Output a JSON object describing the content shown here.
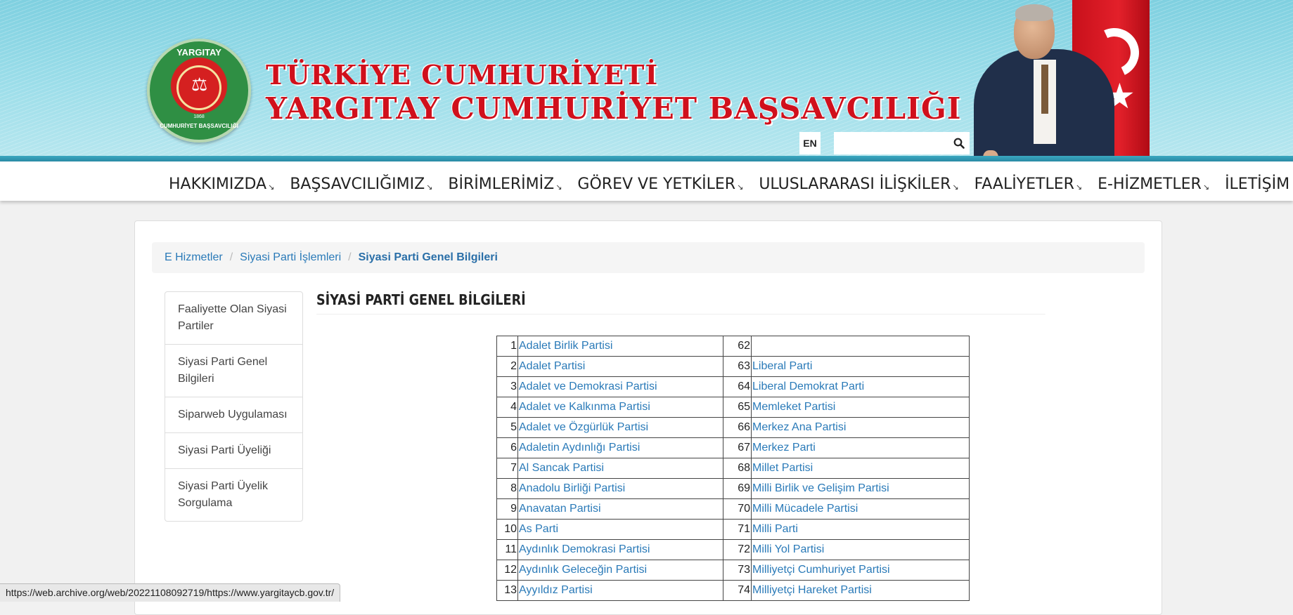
{
  "header": {
    "seal_top": "YARGITAY",
    "seal_bottom": "CUMHURİYET BAŞSAVCILIĞI",
    "seal_year": "1868",
    "title_line1": "TÜRKİYE CUMHURİYETİ",
    "title_line2": "YARGITAY CUMHURİYET BAŞSAVCILIĞI",
    "lang_button": "EN",
    "search_value": "",
    "search_placeholder": ""
  },
  "nav": {
    "items": [
      {
        "label": "HAKKIMIZDA",
        "has_dropdown": true
      },
      {
        "label": "BAŞSAVCILIĞIMIZ",
        "has_dropdown": true
      },
      {
        "label": "BİRİMLERİMİZ",
        "has_dropdown": true
      },
      {
        "label": "GÖREV VE YETKİLER",
        "has_dropdown": true
      },
      {
        "label": "ULUSLARARASI İLİŞKİLER",
        "has_dropdown": true
      },
      {
        "label": "FAALİYETLER",
        "has_dropdown": true
      },
      {
        "label": "E-HİZMETLER",
        "has_dropdown": true
      },
      {
        "label": "İLETİŞİM",
        "has_dropdown": false
      }
    ],
    "dropdown_glyph": "↘"
  },
  "breadcrumb": {
    "items": [
      "E Hizmetler",
      "Siyasi Parti İşlemleri",
      "Siyasi Parti Genel Bilgileri"
    ],
    "separator": "/"
  },
  "sidebar": {
    "items": [
      "Faaliyette Olan Siyasi Partiler",
      "Siyasi Parti Genel Bilgileri",
      "Siparweb Uygulaması",
      "Siyasi Parti Üyeliği",
      "Siyasi Parti Üyelik Sorgulama"
    ]
  },
  "main": {
    "title": "SİYASİ PARTİ GENEL BİLGİLERİ",
    "rows": [
      {
        "n1": "1",
        "p1": "Adalet Birlik Partisi",
        "n2": "62",
        "p2": ""
      },
      {
        "n1": "2",
        "p1": "Adalet Partisi",
        "n2": "63",
        "p2": "Liberal Parti"
      },
      {
        "n1": "3",
        "p1": "Adalet ve Demokrasi Partisi",
        "n2": "64",
        "p2": "Liberal Demokrat Parti"
      },
      {
        "n1": "4",
        "p1": "Adalet ve Kalkınma Partisi",
        "n2": "65",
        "p2": "Memleket Partisi"
      },
      {
        "n1": "5",
        "p1": "Adalet ve Özgürlük Partisi",
        "n2": "66",
        "p2": "Merkez Ana Partisi"
      },
      {
        "n1": "6",
        "p1": "Adaletin Aydınlığı Partisi",
        "n2": "67",
        "p2": "Merkez Parti"
      },
      {
        "n1": "7",
        "p1": "Al Sancak Partisi",
        "n2": "68",
        "p2": "Millet Partisi"
      },
      {
        "n1": "8",
        "p1": "Anadolu Birliği Partisi",
        "n2": "69",
        "p2": "Milli Birlik ve Gelişim Partisi"
      },
      {
        "n1": "9",
        "p1": "Anavatan Partisi",
        "n2": "70",
        "p2": "Milli Mücadele Partisi"
      },
      {
        "n1": "10",
        "p1": "As Parti",
        "n2": "71",
        "p2": "Milli Parti"
      },
      {
        "n1": "11",
        "p1": "Aydınlık Demokrasi Partisi",
        "n2": "72",
        "p2": "Milli Yol Partisi"
      },
      {
        "n1": "12",
        "p1": "Aydınlık Geleceğin Partisi",
        "n2": "73",
        "p2": "Milliyetçi Cumhuriyet Partisi"
      },
      {
        "n1": "13",
        "p1": "Ayyıldız Partisi",
        "n2": "74",
        "p2": "Milliyetçi Hareket Partisi"
      }
    ]
  },
  "status_bar": {
    "url": "https://web.archive.org/web/20221108092719/https://www.yargitaycb.gov.tr/"
  },
  "colors": {
    "banner": "#9bdde9",
    "title_red": "#d0101c",
    "link": "#2a7ab8",
    "flag_red": "#e3202a"
  }
}
